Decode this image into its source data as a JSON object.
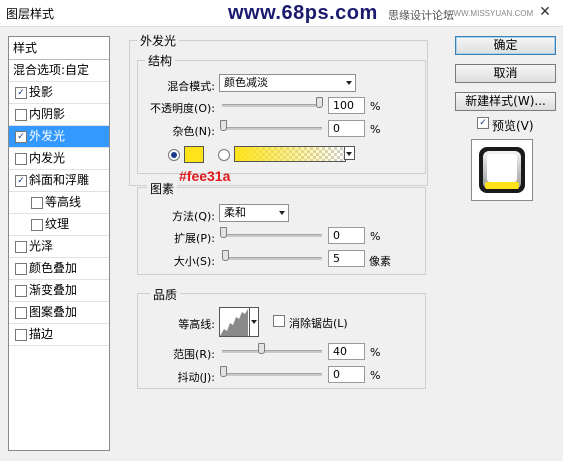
{
  "window": {
    "title": "图层样式",
    "close_glyph": "✕"
  },
  "watermark": {
    "site": "www.68ps.com",
    "forum": "思缘设计论坛",
    "url": "WWW.MISSYUAN.COM"
  },
  "styles_panel": {
    "header": "样式",
    "blend_options": "混合选项:自定",
    "items": [
      {
        "label": "投影",
        "checked": true,
        "selected": false,
        "indent": false
      },
      {
        "label": "内阴影",
        "checked": false,
        "selected": false,
        "indent": false
      },
      {
        "label": "外发光",
        "checked": true,
        "selected": true,
        "indent": false
      },
      {
        "label": "内发光",
        "checked": false,
        "selected": false,
        "indent": false
      },
      {
        "label": "斜面和浮雕",
        "checked": true,
        "selected": false,
        "indent": false
      },
      {
        "label": "等高线",
        "checked": false,
        "selected": false,
        "indent": true
      },
      {
        "label": "纹理",
        "checked": false,
        "selected": false,
        "indent": true
      },
      {
        "label": "光泽",
        "checked": false,
        "selected": false,
        "indent": false
      },
      {
        "label": "颜色叠加",
        "checked": false,
        "selected": false,
        "indent": false
      },
      {
        "label": "渐变叠加",
        "checked": false,
        "selected": false,
        "indent": false
      },
      {
        "label": "图案叠加",
        "checked": false,
        "selected": false,
        "indent": false
      },
      {
        "label": "描边",
        "checked": false,
        "selected": false,
        "indent": false
      }
    ]
  },
  "outer_glow": {
    "title": "外发光",
    "structure": {
      "title": "结构",
      "blend_mode_label": "混合模式:",
      "blend_mode_value": "颜色减淡",
      "opacity_label": "不透明度(O):",
      "opacity_value": "100",
      "opacity_unit": "%",
      "opacity_fraction": 1.0,
      "noise_label": "杂色(N):",
      "noise_value": "0",
      "noise_unit": "%",
      "noise_fraction": 0.0,
      "glow_color": "#fee31a",
      "color_mode_selected": "solid"
    },
    "annotation": "#fee31a",
    "elements": {
      "title": "图素",
      "technique_label": "方法(Q):",
      "technique_value": "柔和",
      "spread_label": "扩展(P):",
      "spread_value": "0",
      "spread_unit": "%",
      "spread_fraction": 0.0,
      "size_label": "大小(S):",
      "size_value": "5",
      "size_unit": "像素",
      "size_fraction": 0.02
    },
    "quality": {
      "title": "品质",
      "contour_label": "等高线:",
      "antialias_label": "消除锯齿(L)",
      "antialias_checked": false,
      "range_label": "范围(R):",
      "range_value": "40",
      "range_unit": "%",
      "range_fraction": 0.4,
      "jitter_label": "抖动(J):",
      "jitter_value": "0",
      "jitter_unit": "%",
      "jitter_fraction": 0.0
    }
  },
  "buttons": {
    "ok": "确定",
    "cancel": "取消",
    "new_style": "新建样式(W)..."
  },
  "preview": {
    "label": "预览(V)",
    "checked": true,
    "check_glyph": "✓"
  },
  "colors": {
    "accent": "#3399ff",
    "glow": "#fee31a",
    "annotation": "#e01a1a"
  }
}
